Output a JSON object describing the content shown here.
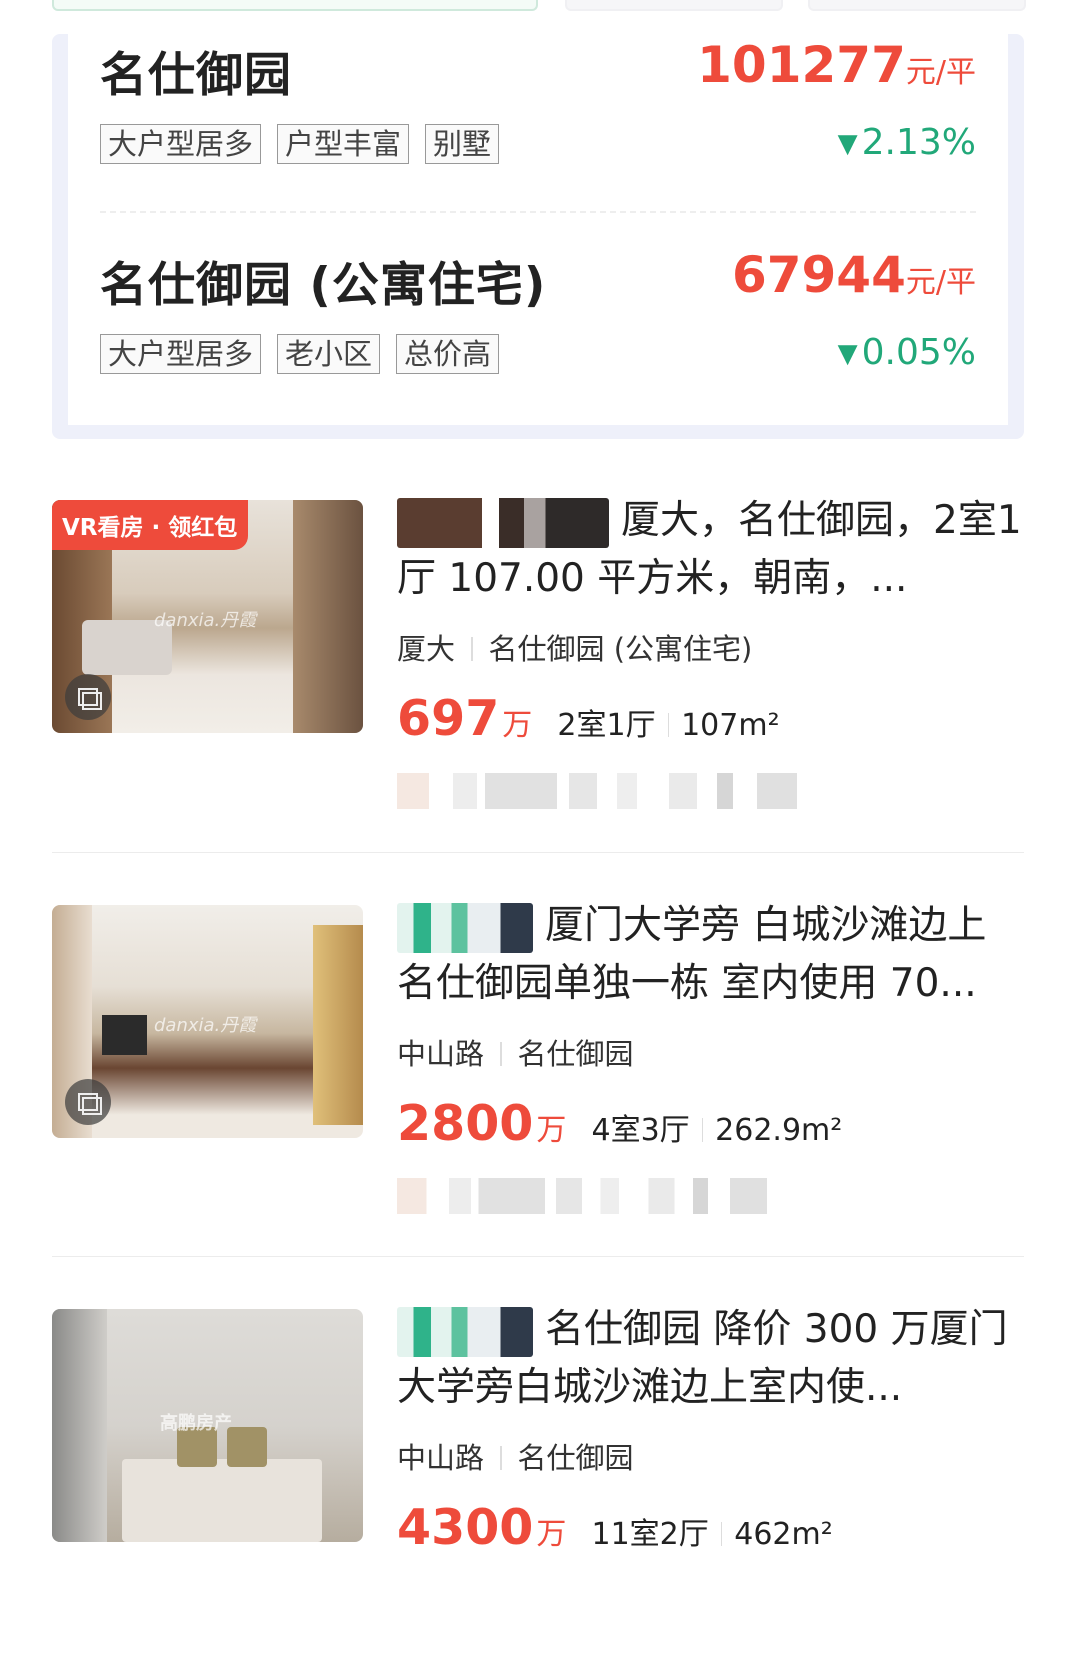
{
  "communities": [
    {
      "name": "名仕御园",
      "price": "101277",
      "price_unit": "元/平",
      "tags": [
        "大户型居多",
        "户型丰富",
        "别墅"
      ],
      "change": "2.13%",
      "change_color": "#21a879"
    },
    {
      "name": "名仕御园 (公寓住宅)",
      "price": "67944",
      "price_unit": "元/平",
      "tags": [
        "大户型居多",
        "老小区",
        "总价高"
      ],
      "change": "0.05%",
      "change_color": "#21a879"
    }
  ],
  "listings": [
    {
      "badge": "VR看房 · 领红包",
      "watermark": "danxia.丹霞",
      "title": "厦大，名仕御园，2室1厅 107.00 平方米，朝南，...",
      "district": "厦大",
      "community": "名仕御园 (公寓住宅)",
      "price": "697",
      "price_unit": "万",
      "rooms": "2室1厅",
      "area": "107m²"
    },
    {
      "watermark": "danxia.丹霞",
      "title": "厦门大学旁 白城沙滩边上名仕御园单独一栋 室内使用 70...",
      "district": "中山路",
      "community": "名仕御园",
      "price": "2800",
      "price_unit": "万",
      "rooms": "4室3厅",
      "area": "262.9m²"
    },
    {
      "watermark": "高鹏房产",
      "title": "名仕御园 降价 300 万厦门大学旁白城沙滩边上室内使...",
      "district": "中山路",
      "community": "名仕御园",
      "price": "4300",
      "price_unit": "万",
      "rooms": "11室2厅",
      "area": "462m²"
    }
  ],
  "colors": {
    "accent_red": "#ee4b3b",
    "down_green": "#21a879",
    "card_bg": "#eef0fa"
  }
}
